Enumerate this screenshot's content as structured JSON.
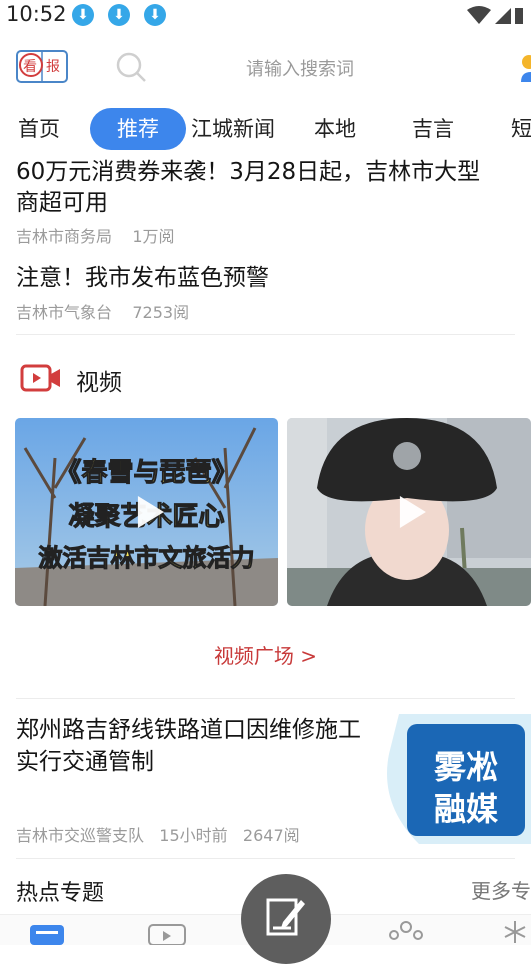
{
  "status_bar": {
    "time": "10:52"
  },
  "header": {
    "logo_text_1": "看",
    "logo_text_2": "报",
    "search_placeholder": "请输入搜索词"
  },
  "tabs": [
    {
      "label": "首页"
    },
    {
      "label": "推荐"
    },
    {
      "label": "江城新闻"
    },
    {
      "label": "本地"
    },
    {
      "label": "吉言"
    },
    {
      "label": "短"
    }
  ],
  "news": [
    {
      "title_line1": "60万元消费券来袭！3月28日起，吉林市大型",
      "title_line2": "商超可用",
      "source": "吉林市商务局",
      "views": "1万阅"
    },
    {
      "title": "注意！我市发布蓝色预警",
      "source": "吉林市气象台",
      "views": "7253阅"
    }
  ],
  "video_section": {
    "title": "视频",
    "thumb1_lines": [
      "《春雪与琵琶》",
      "凝聚艺术匠心",
      "激活吉林市文旅活力"
    ],
    "more_link": "视频广场 >"
  },
  "news2": {
    "title": "郑州路吉舒线铁路道口因维修施工实行交通管制",
    "image_text_1": "雾凇",
    "image_text_2": "融媒",
    "source": "吉林市交巡警支队",
    "time": "15小时前",
    "views": "2647阅"
  },
  "hot": {
    "title": "热点专题",
    "more": "更多专"
  },
  "colors": {
    "accent": "#3d86ec",
    "video_link": "#c83a3a",
    "icon_blue": "#35a7e8"
  }
}
